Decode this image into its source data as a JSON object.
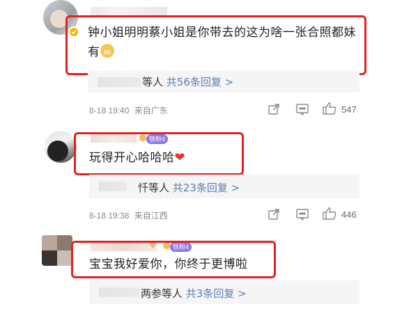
{
  "comments": [
    {
      "text": "钟小姐明明蔡小姐是你带去的这为啥一张合照都妹有",
      "replies": {
        "prefix": "等人",
        "link": "共56条回复 >"
      },
      "time": "8-18 19:40",
      "location": "来自广东",
      "likes": "547"
    },
    {
      "text": "玩得开心哈哈哈",
      "badge": "铁粉4",
      "replies": {
        "prefix": "忏等人",
        "link": "共23条回复 >"
      },
      "time": "8-18 19:38",
      "location": "来自江西",
      "likes": "446"
    },
    {
      "text": "宝宝我好爱你，你终于更博啦",
      "badge": "铁粉4",
      "replies": {
        "prefix": "两参等人",
        "link": "共3条回复 >"
      }
    }
  ],
  "icons": {
    "share": "share-icon",
    "comment": "comment-icon",
    "like": "thumbs-up-icon",
    "verified": "verified-badge-icon"
  },
  "colors": {
    "highlight_border": "#e3221f",
    "link": "#5b7fb5",
    "fan_badge": "#8a78e6"
  }
}
